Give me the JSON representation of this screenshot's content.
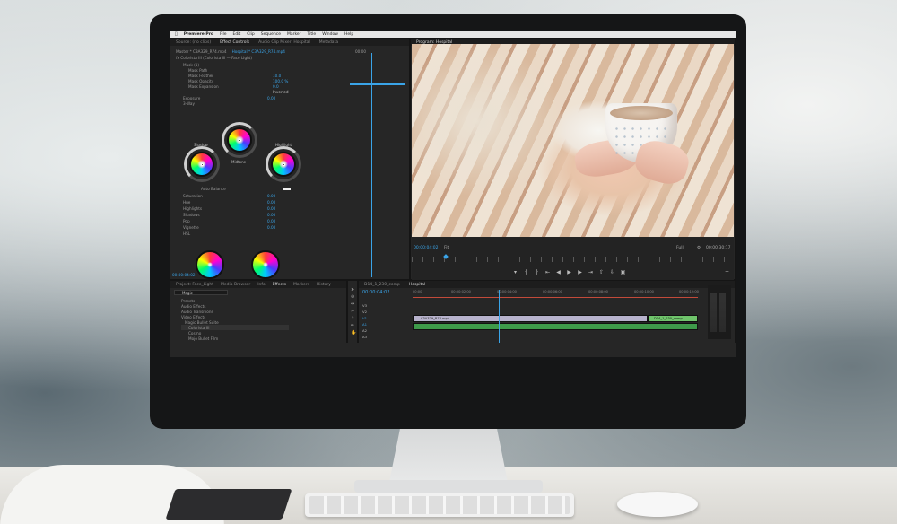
{
  "menubar": {
    "app": "Premiere Pro",
    "items": [
      "File",
      "Edit",
      "Clip",
      "Sequence",
      "Marker",
      "Title",
      "Window",
      "Help"
    ]
  },
  "effect_panel": {
    "tabs": [
      "Source: (no clips)",
      "Effect Controls",
      "Audio Clip Mixer: Hospital",
      "Metadata"
    ],
    "active_tab": "Effect Controls",
    "master_label": "Master * C3A329_R74.mp4",
    "sequence_label": "Hospital * C3A329_R74.mp4",
    "timecode": "00:00",
    "effect_name": "Colorista III (Colorista III — Face Light)",
    "rows": [
      {
        "label": "Mask (1)",
        "value": ""
      },
      {
        "label": "Mask Path",
        "value": ""
      },
      {
        "label": "Mask Feather",
        "value": "10.0"
      },
      {
        "label": "Mask Opacity",
        "value": "100.0 %"
      },
      {
        "label": "Mask Expansion",
        "value": "0.0"
      },
      {
        "label": "",
        "value": "Inverted"
      },
      {
        "label": "Exposure",
        "value": "0.00"
      },
      {
        "label": "3-Way",
        "value": ""
      }
    ],
    "wheel_labels": {
      "shadow": "Shadow",
      "midtone": "Midtone",
      "highlight": "Highlight"
    },
    "auto_balance": "Auto Balance",
    "adjust_rows": [
      {
        "label": "Saturation",
        "value": "0.00"
      },
      {
        "label": "Hue",
        "value": "0.00"
      },
      {
        "label": "Highlights",
        "value": "0.00"
      },
      {
        "label": "Shadows",
        "value": "0.00"
      },
      {
        "label": "Pop",
        "value": "0.00"
      },
      {
        "label": "Vignette",
        "value": "0.00"
      },
      {
        "label": "HSL",
        "value": ""
      }
    ],
    "footer_timecode": "00:00:04:02"
  },
  "program_monitor": {
    "tab": "Program: Hospital",
    "timecode": "00:00:04:02",
    "fit": "Fit",
    "quality": "Full",
    "duration": "00:00:30:17"
  },
  "project_panel": {
    "tabs": [
      "Project: Face_Light",
      "Media Browser",
      "Info",
      "Effects",
      "Markers",
      "History"
    ],
    "active_tab": "Effects",
    "search": "Magic",
    "tree": [
      "Presets",
      "Audio Effects",
      "Audio Transitions",
      "Video Effects",
      "Magic Bullet Suite",
      "Colorista III",
      "Cosmo",
      "Mojo Bullet Film"
    ]
  },
  "timeline": {
    "tabs": [
      "D14_1_230_comp",
      "Hospital"
    ],
    "active_tab": "Hospital",
    "timecode": "00:00:04:02",
    "ruler": [
      "00:00",
      "00:00:02:00",
      "00:00:04:00",
      "00:00:06:00",
      "00:00:08:00",
      "00:00:10:00",
      "00:00:12:00"
    ],
    "tracks": [
      "V3",
      "V2",
      "V1",
      "A1",
      "A2",
      "A3"
    ],
    "clips": [
      {
        "name": "C3A329_R74.mp4",
        "track": "V1"
      },
      {
        "name": "D14_1_230_comp",
        "track": "V1"
      }
    ]
  },
  "colors": {
    "accent": "#3aa4e8",
    "panel": "#262626",
    "clip_video": "#b7b2cc",
    "clip_audio": "#3e9a4a"
  }
}
